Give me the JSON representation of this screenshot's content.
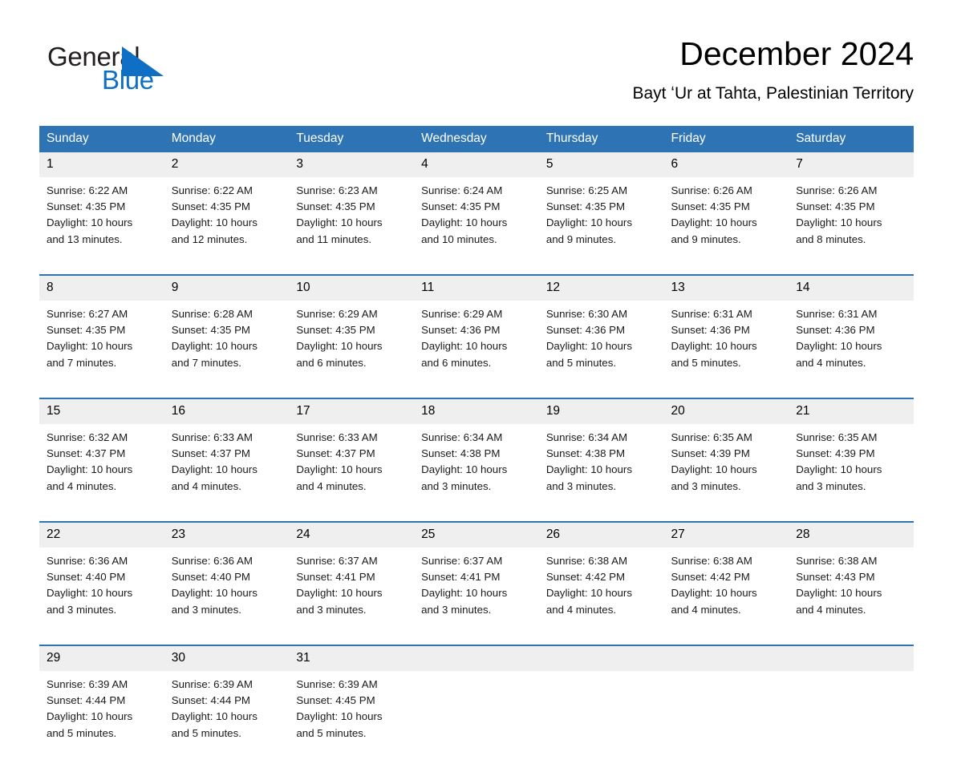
{
  "brand": {
    "name_part1": "General",
    "name_part2": "Blue",
    "accent_color": "#0f6fc5",
    "triangle_icon": "triangle-logo-icon"
  },
  "header": {
    "title": "December 2024",
    "subtitle": "Bayt ʻUr at Tahta, Palestinian Territory"
  },
  "calendar": {
    "header_bg": "#2e74b5",
    "daynum_bg": "#efefef",
    "weekdays": [
      "Sunday",
      "Monday",
      "Tuesday",
      "Wednesday",
      "Thursday",
      "Friday",
      "Saturday"
    ],
    "weeks": [
      [
        {
          "day": "1",
          "sunrise": "Sunrise: 6:22 AM",
          "sunset": "Sunset: 4:35 PM",
          "daylight1": "Daylight: 10 hours",
          "daylight2": "and 13 minutes."
        },
        {
          "day": "2",
          "sunrise": "Sunrise: 6:22 AM",
          "sunset": "Sunset: 4:35 PM",
          "daylight1": "Daylight: 10 hours",
          "daylight2": "and 12 minutes."
        },
        {
          "day": "3",
          "sunrise": "Sunrise: 6:23 AM",
          "sunset": "Sunset: 4:35 PM",
          "daylight1": "Daylight: 10 hours",
          "daylight2": "and 11 minutes."
        },
        {
          "day": "4",
          "sunrise": "Sunrise: 6:24 AM",
          "sunset": "Sunset: 4:35 PM",
          "daylight1": "Daylight: 10 hours",
          "daylight2": "and 10 minutes."
        },
        {
          "day": "5",
          "sunrise": "Sunrise: 6:25 AM",
          "sunset": "Sunset: 4:35 PM",
          "daylight1": "Daylight: 10 hours",
          "daylight2": "and 9 minutes."
        },
        {
          "day": "6",
          "sunrise": "Sunrise: 6:26 AM",
          "sunset": "Sunset: 4:35 PM",
          "daylight1": "Daylight: 10 hours",
          "daylight2": "and 9 minutes."
        },
        {
          "day": "7",
          "sunrise": "Sunrise: 6:26 AM",
          "sunset": "Sunset: 4:35 PM",
          "daylight1": "Daylight: 10 hours",
          "daylight2": "and 8 minutes."
        }
      ],
      [
        {
          "day": "8",
          "sunrise": "Sunrise: 6:27 AM",
          "sunset": "Sunset: 4:35 PM",
          "daylight1": "Daylight: 10 hours",
          "daylight2": "and 7 minutes."
        },
        {
          "day": "9",
          "sunrise": "Sunrise: 6:28 AM",
          "sunset": "Sunset: 4:35 PM",
          "daylight1": "Daylight: 10 hours",
          "daylight2": "and 7 minutes."
        },
        {
          "day": "10",
          "sunrise": "Sunrise: 6:29 AM",
          "sunset": "Sunset: 4:35 PM",
          "daylight1": "Daylight: 10 hours",
          "daylight2": "and 6 minutes."
        },
        {
          "day": "11",
          "sunrise": "Sunrise: 6:29 AM",
          "sunset": "Sunset: 4:36 PM",
          "daylight1": "Daylight: 10 hours",
          "daylight2": "and 6 minutes."
        },
        {
          "day": "12",
          "sunrise": "Sunrise: 6:30 AM",
          "sunset": "Sunset: 4:36 PM",
          "daylight1": "Daylight: 10 hours",
          "daylight2": "and 5 minutes."
        },
        {
          "day": "13",
          "sunrise": "Sunrise: 6:31 AM",
          "sunset": "Sunset: 4:36 PM",
          "daylight1": "Daylight: 10 hours",
          "daylight2": "and 5 minutes."
        },
        {
          "day": "14",
          "sunrise": "Sunrise: 6:31 AM",
          "sunset": "Sunset: 4:36 PM",
          "daylight1": "Daylight: 10 hours",
          "daylight2": "and 4 minutes."
        }
      ],
      [
        {
          "day": "15",
          "sunrise": "Sunrise: 6:32 AM",
          "sunset": "Sunset: 4:37 PM",
          "daylight1": "Daylight: 10 hours",
          "daylight2": "and 4 minutes."
        },
        {
          "day": "16",
          "sunrise": "Sunrise: 6:33 AM",
          "sunset": "Sunset: 4:37 PM",
          "daylight1": "Daylight: 10 hours",
          "daylight2": "and 4 minutes."
        },
        {
          "day": "17",
          "sunrise": "Sunrise: 6:33 AM",
          "sunset": "Sunset: 4:37 PM",
          "daylight1": "Daylight: 10 hours",
          "daylight2": "and 4 minutes."
        },
        {
          "day": "18",
          "sunrise": "Sunrise: 6:34 AM",
          "sunset": "Sunset: 4:38 PM",
          "daylight1": "Daylight: 10 hours",
          "daylight2": "and 3 minutes."
        },
        {
          "day": "19",
          "sunrise": "Sunrise: 6:34 AM",
          "sunset": "Sunset: 4:38 PM",
          "daylight1": "Daylight: 10 hours",
          "daylight2": "and 3 minutes."
        },
        {
          "day": "20",
          "sunrise": "Sunrise: 6:35 AM",
          "sunset": "Sunset: 4:39 PM",
          "daylight1": "Daylight: 10 hours",
          "daylight2": "and 3 minutes."
        },
        {
          "day": "21",
          "sunrise": "Sunrise: 6:35 AM",
          "sunset": "Sunset: 4:39 PM",
          "daylight1": "Daylight: 10 hours",
          "daylight2": "and 3 minutes."
        }
      ],
      [
        {
          "day": "22",
          "sunrise": "Sunrise: 6:36 AM",
          "sunset": "Sunset: 4:40 PM",
          "daylight1": "Daylight: 10 hours",
          "daylight2": "and 3 minutes."
        },
        {
          "day": "23",
          "sunrise": "Sunrise: 6:36 AM",
          "sunset": "Sunset: 4:40 PM",
          "daylight1": "Daylight: 10 hours",
          "daylight2": "and 3 minutes."
        },
        {
          "day": "24",
          "sunrise": "Sunrise: 6:37 AM",
          "sunset": "Sunset: 4:41 PM",
          "daylight1": "Daylight: 10 hours",
          "daylight2": "and 3 minutes."
        },
        {
          "day": "25",
          "sunrise": "Sunrise: 6:37 AM",
          "sunset": "Sunset: 4:41 PM",
          "daylight1": "Daylight: 10 hours",
          "daylight2": "and 3 minutes."
        },
        {
          "day": "26",
          "sunrise": "Sunrise: 6:38 AM",
          "sunset": "Sunset: 4:42 PM",
          "daylight1": "Daylight: 10 hours",
          "daylight2": "and 4 minutes."
        },
        {
          "day": "27",
          "sunrise": "Sunrise: 6:38 AM",
          "sunset": "Sunset: 4:42 PM",
          "daylight1": "Daylight: 10 hours",
          "daylight2": "and 4 minutes."
        },
        {
          "day": "28",
          "sunrise": "Sunrise: 6:38 AM",
          "sunset": "Sunset: 4:43 PM",
          "daylight1": "Daylight: 10 hours",
          "daylight2": "and 4 minutes."
        }
      ],
      [
        {
          "day": "29",
          "sunrise": "Sunrise: 6:39 AM",
          "sunset": "Sunset: 4:44 PM",
          "daylight1": "Daylight: 10 hours",
          "daylight2": "and 5 minutes."
        },
        {
          "day": "30",
          "sunrise": "Sunrise: 6:39 AM",
          "sunset": "Sunset: 4:44 PM",
          "daylight1": "Daylight: 10 hours",
          "daylight2": "and 5 minutes."
        },
        {
          "day": "31",
          "sunrise": "Sunrise: 6:39 AM",
          "sunset": "Sunset: 4:45 PM",
          "daylight1": "Daylight: 10 hours",
          "daylight2": "and 5 minutes."
        },
        {
          "day": "",
          "sunrise": "",
          "sunset": "",
          "daylight1": "",
          "daylight2": ""
        },
        {
          "day": "",
          "sunrise": "",
          "sunset": "",
          "daylight1": "",
          "daylight2": ""
        },
        {
          "day": "",
          "sunrise": "",
          "sunset": "",
          "daylight1": "",
          "daylight2": ""
        },
        {
          "day": "",
          "sunrise": "",
          "sunset": "",
          "daylight1": "",
          "daylight2": ""
        }
      ]
    ]
  }
}
